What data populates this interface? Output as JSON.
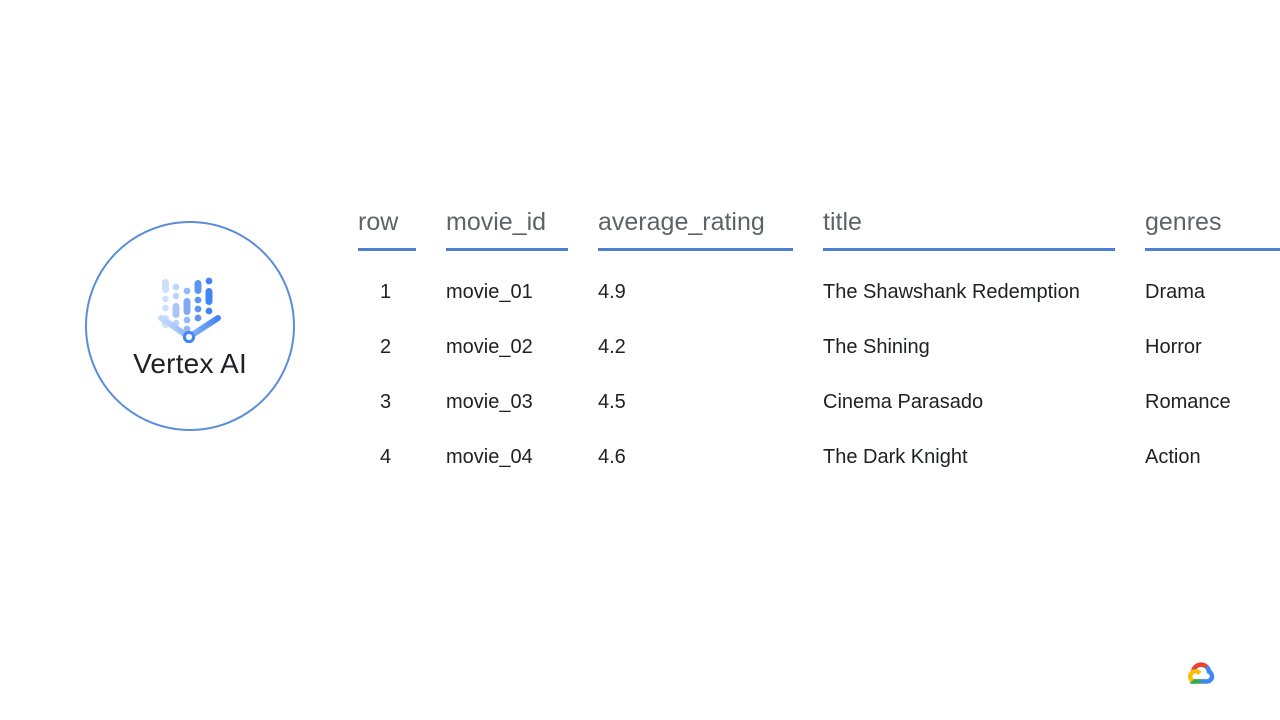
{
  "brand": {
    "label": "Vertex AI",
    "icon_name": "vertex-ai-funnel-icon",
    "circle_color": "#5b8dd9",
    "icon_color_light": "#aecbfa",
    "icon_color_dark": "#4285f4"
  },
  "table": {
    "accent_color": "#4a7fd4",
    "header_color": "#5f6368",
    "cell_color": "#202124",
    "columns": [
      {
        "key": "row",
        "label": "row"
      },
      {
        "key": "movie_id",
        "label": "movie_id"
      },
      {
        "key": "average_rating",
        "label": "average_rating"
      },
      {
        "key": "title",
        "label": "title"
      },
      {
        "key": "genres",
        "label": "genres"
      }
    ],
    "rows": [
      {
        "row": "1",
        "movie_id": "movie_01",
        "average_rating": "4.9",
        "title": "The Shawshank Redemption",
        "genres": "Drama"
      },
      {
        "row": "2",
        "movie_id": "movie_02",
        "average_rating": "4.2",
        "title": "The Shining",
        "genres": "Horror"
      },
      {
        "row": "3",
        "movie_id": "movie_03",
        "average_rating": "4.5",
        "title": "Cinema Parasado",
        "genres": "Romance"
      },
      {
        "row": "4",
        "movie_id": "movie_04",
        "average_rating": "4.6",
        "title": "The Dark Knight",
        "genres": "Action"
      }
    ]
  },
  "footer": {
    "logo_name": "google-cloud-logo",
    "logo_colors": {
      "red": "#ea4335",
      "yellow": "#fbbc04",
      "green": "#34a853",
      "blue": "#4285f4"
    }
  }
}
